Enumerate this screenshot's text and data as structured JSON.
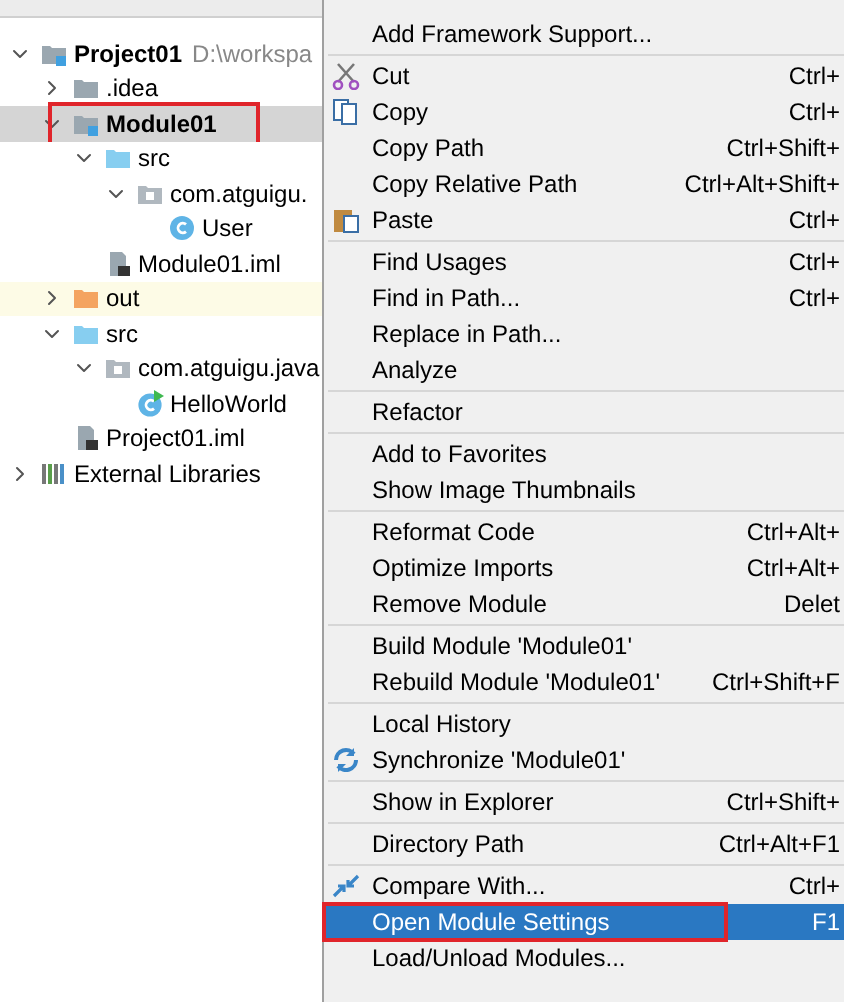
{
  "tree": [
    {
      "label": "Project01",
      "path": "D:\\workspa",
      "kind": "module",
      "expanded": true,
      "selected": false,
      "outlined": false,
      "children": [
        {
          "label": ".idea",
          "kind": "folder",
          "expanded": false,
          "selected": false,
          "outlined": false
        },
        {
          "label": "Module01",
          "kind": "module",
          "expanded": true,
          "selected": true,
          "outlined": true,
          "children": [
            {
              "label": "src",
              "kind": "source",
              "expanded": true,
              "selected": false,
              "outlined": false,
              "children": [
                {
                  "label": "com.atguigu.",
                  "kind": "package",
                  "expanded": true,
                  "selected": false,
                  "outlined": false,
                  "children": [
                    {
                      "label": "User",
                      "kind": "class",
                      "selected": false,
                      "outlined": false
                    }
                  ]
                }
              ]
            },
            {
              "label": "Module01.iml",
              "kind": "file",
              "selected": false,
              "outlined": false
            }
          ]
        },
        {
          "label": "out",
          "kind": "excluded",
          "expanded": false,
          "selected": false,
          "outlined": false
        },
        {
          "label": "src",
          "kind": "source",
          "expanded": true,
          "selected": false,
          "outlined": false,
          "children": [
            {
              "label": "com.atguigu.java",
              "kind": "package",
              "expanded": true,
              "selected": false,
              "outlined": false,
              "children": [
                {
                  "label": "HelloWorld",
                  "kind": "main-class",
                  "selected": false,
                  "outlined": false
                }
              ]
            }
          ]
        },
        {
          "label": "Project01.iml",
          "kind": "file",
          "selected": false,
          "outlined": false
        }
      ]
    },
    {
      "label": "External Libraries",
      "kind": "library",
      "expanded": false,
      "selected": false,
      "outlined": false
    }
  ],
  "menu": {
    "groups": [
      [
        {
          "label": "Add Framework Support...",
          "kind": "plain",
          "selected": false,
          "outlined": false
        }
      ],
      [
        {
          "label": "Cut",
          "kind": "cut",
          "shortcut": "Ctrl+",
          "selected": false,
          "outlined": false
        },
        {
          "label": "Copy",
          "kind": "copy",
          "shortcut": "Ctrl+",
          "selected": false,
          "outlined": false
        },
        {
          "label": "Copy Path",
          "kind": "plain",
          "shortcut": "Ctrl+Shift+",
          "selected": false,
          "outlined": false
        },
        {
          "label": "Copy Relative Path",
          "kind": "plain",
          "shortcut": "Ctrl+Alt+Shift+",
          "selected": false,
          "outlined": false
        },
        {
          "label": "Paste",
          "kind": "paste",
          "shortcut": "Ctrl+",
          "selected": false,
          "outlined": false
        }
      ],
      [
        {
          "label": "Find Usages",
          "kind": "plain",
          "shortcut": "Ctrl+",
          "selected": false,
          "outlined": false
        },
        {
          "label": "Find in Path...",
          "kind": "plain",
          "shortcut": "Ctrl+",
          "selected": false,
          "outlined": false
        },
        {
          "label": "Replace in Path...",
          "kind": "plain",
          "selected": false,
          "outlined": false
        },
        {
          "label": "Analyze",
          "kind": "plain",
          "selected": false,
          "outlined": false
        }
      ],
      [
        {
          "label": "Refactor",
          "kind": "plain",
          "selected": false,
          "outlined": false
        }
      ],
      [
        {
          "label": "Add to Favorites",
          "kind": "plain",
          "selected": false,
          "outlined": false
        },
        {
          "label": "Show Image Thumbnails",
          "kind": "plain",
          "selected": false,
          "outlined": false
        }
      ],
      [
        {
          "label": "Reformat Code",
          "kind": "plain",
          "shortcut": "Ctrl+Alt+",
          "selected": false,
          "outlined": false
        },
        {
          "label": "Optimize Imports",
          "kind": "plain",
          "shortcut": "Ctrl+Alt+",
          "selected": false,
          "outlined": false
        },
        {
          "label": "Remove Module",
          "kind": "plain",
          "shortcut": "Delet",
          "selected": false,
          "outlined": false
        }
      ],
      [
        {
          "label": "Build Module 'Module01'",
          "kind": "plain",
          "selected": false,
          "outlined": false
        },
        {
          "label": "Rebuild Module 'Module01'",
          "kind": "plain",
          "shortcut": "Ctrl+Shift+F",
          "selected": false,
          "outlined": false
        }
      ],
      [
        {
          "label": "Local History",
          "kind": "plain",
          "selected": false,
          "outlined": false
        },
        {
          "label": "Synchronize 'Module01'",
          "kind": "sync",
          "selected": false,
          "outlined": false
        }
      ],
      [
        {
          "label": "Show in Explorer",
          "kind": "plain",
          "shortcut": "Ctrl+Shift+",
          "selected": false,
          "outlined": false
        }
      ],
      [
        {
          "label": "Directory Path",
          "kind": "plain",
          "shortcut": "Ctrl+Alt+F1",
          "selected": false,
          "outlined": false
        }
      ],
      [
        {
          "label": "Compare With...",
          "kind": "compare",
          "shortcut": "Ctrl+",
          "selected": false,
          "outlined": false
        },
        {
          "label": "Open Module Settings",
          "kind": "plain",
          "shortcut": "F1",
          "selected": true,
          "outlined": true
        },
        {
          "label": "Load/Unload Modules...",
          "kind": "plain",
          "selected": false,
          "outlined": false
        }
      ]
    ]
  }
}
